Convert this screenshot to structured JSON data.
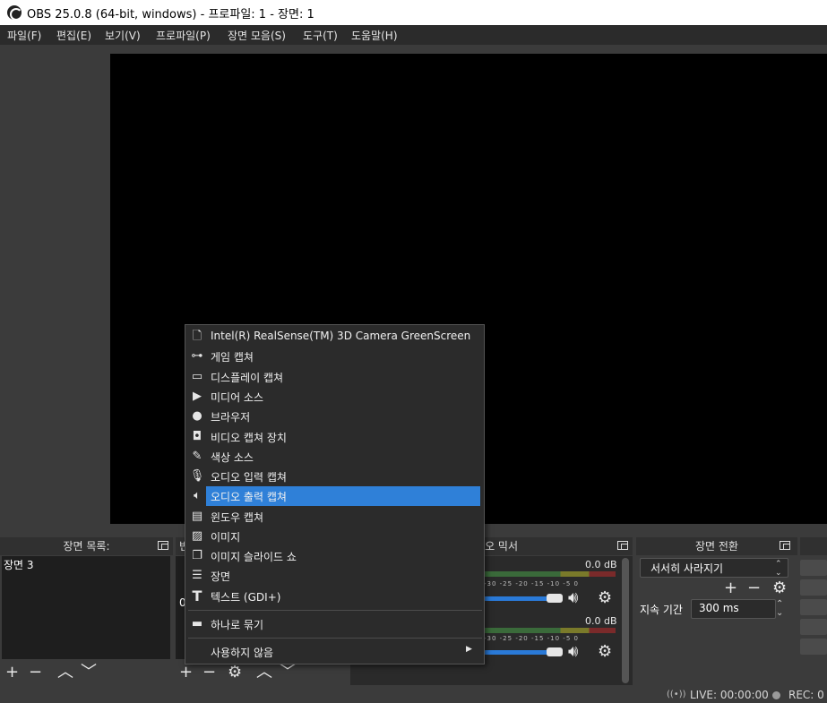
{
  "window": {
    "title": "OBS 25.0.8 (64-bit, windows) - 프로파일: 1 - 장면: 1"
  },
  "menubar": [
    "파일(F)",
    "편집(E)",
    "보기(V)",
    "프로파일(P)",
    "장면 모음(S)",
    "도구(T)",
    "도움말(H)"
  ],
  "docks": {
    "scenes": {
      "title": "장면 목록:",
      "items": [
        "장면 3"
      ]
    },
    "mixer": {
      "title": "오디오 믹서",
      "tracks": [
        {
          "db": "0.0 dB"
        },
        {
          "db": "0.0 dB"
        }
      ],
      "meter_ticks": "-30  -25  -20  -15  -10   -5   0"
    },
    "transitions": {
      "title": "장면 전환",
      "selected": "서서히 사라지기",
      "duration_label": "지속 기간",
      "duration_value": "300 ms"
    }
  },
  "sources_partial": {
    "header_letter": "빈",
    "row_letter": "0"
  },
  "status": {
    "live": "LIVE: 00:00:00",
    "rec": "REC: 0"
  },
  "context_menu": {
    "highlighted_index": 8,
    "items": [
      {
        "label": "Intel(R) RealSense(TM) 3D Camera GreenScreen",
        "icon": "file-icon"
      },
      {
        "label": "게임 캡쳐",
        "icon": "gamepad-icon"
      },
      {
        "label": "디스플레이 캡쳐",
        "icon": "monitor-icon"
      },
      {
        "label": "미디어 소스",
        "icon": "play-icon"
      },
      {
        "label": "브라우저",
        "icon": "globe-icon"
      },
      {
        "label": "비디오 캡쳐 장치",
        "icon": "camera-icon"
      },
      {
        "label": "색상 소스",
        "icon": "brush-icon"
      },
      {
        "label": "오디오 입력 캡쳐",
        "icon": "microphone-icon"
      },
      {
        "label": "오디오 출력 캡쳐",
        "icon": "speaker-icon"
      },
      {
        "label": "윈도우 캡쳐",
        "icon": "window-icon"
      },
      {
        "label": "이미지",
        "icon": "image-icon"
      },
      {
        "label": "이미지 슬라이드 쇼",
        "icon": "slideshow-icon"
      },
      {
        "label": "장면",
        "icon": "list-icon"
      },
      {
        "label": "텍스트 (GDI+)",
        "icon": "text-icon"
      }
    ],
    "group_label": "하나로 묶기",
    "deprecated_label": "사용하지 않음"
  }
}
